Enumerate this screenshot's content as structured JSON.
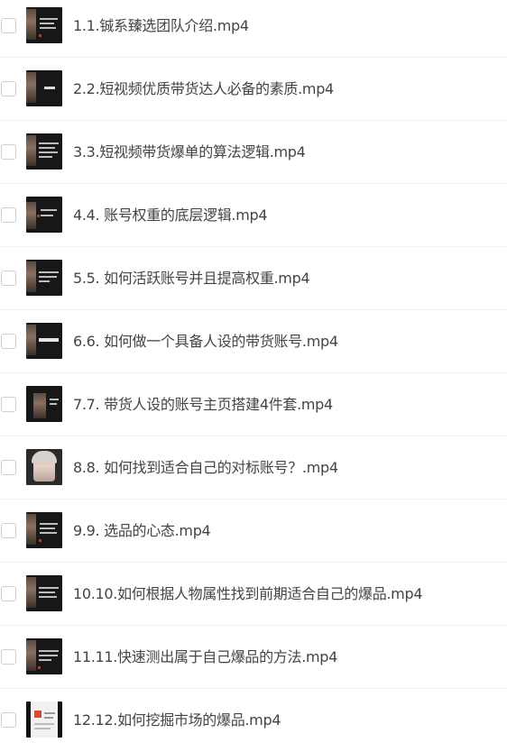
{
  "files": [
    {
      "name": "1.1.铖系臻选团队介绍.mp4",
      "thumbnail": "video-thumbnail-dark"
    },
    {
      "name": "2.2.短视频优质带货达人必备的素质.mp4",
      "thumbnail": "video-thumbnail-dark"
    },
    {
      "name": "3.3.短视频带货爆单的算法逻辑.mp4",
      "thumbnail": "video-thumbnail-dark"
    },
    {
      "name": "4.4. 账号权重的底层逻辑.mp4",
      "thumbnail": "video-thumbnail-dark"
    },
    {
      "name": "5.5. 如何活跃账号并且提高权重.mp4",
      "thumbnail": "video-thumbnail-dark"
    },
    {
      "name": "6.6. 如何做一个具备人设的带货账号.mp4",
      "thumbnail": "video-thumbnail-dark"
    },
    {
      "name": "7.7. 带货人设的账号主页搭建4件套.mp4",
      "thumbnail": "video-thumbnail-dark"
    },
    {
      "name": "8.8. 如何找到适合自己的对标账号？.mp4",
      "thumbnail": "video-thumbnail-portrait"
    },
    {
      "name": "9.9. 选品的心态.mp4",
      "thumbnail": "video-thumbnail-dark"
    },
    {
      "name": "10.10.如何根据人物属性找到前期适合自己的爆品.mp4",
      "thumbnail": "video-thumbnail-dark"
    },
    {
      "name": "11.11.快速测出属于自己爆品的方法.mp4",
      "thumbnail": "video-thumbnail-dark"
    },
    {
      "name": "12.12.如何挖掘市场的爆品.mp4",
      "thumbnail": "video-thumbnail-light"
    }
  ]
}
